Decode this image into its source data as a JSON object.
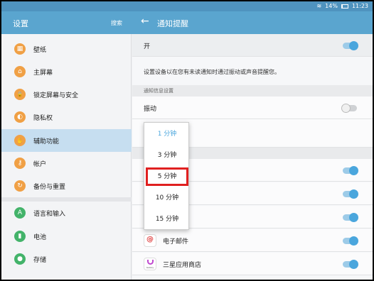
{
  "status_bar": {
    "battery": "14%",
    "time": "11:23"
  },
  "left_header": {
    "title": "设置",
    "search": "搜索"
  },
  "right_header": {
    "title": "通知提醒"
  },
  "sidebar": {
    "items": [
      {
        "label": "壁纸",
        "icon": "wallpaper-icon",
        "glyph": "▦"
      },
      {
        "label": "主屏幕",
        "icon": "home-icon",
        "glyph": "⌂"
      },
      {
        "label": "锁定屏幕与安全",
        "icon": "lock-icon",
        "glyph": "🔒"
      },
      {
        "label": "隐私权",
        "icon": "privacy-icon",
        "glyph": "◐"
      },
      {
        "label": "辅助功能",
        "icon": "accessibility-icon",
        "glyph": "✋"
      },
      {
        "label": "帐户",
        "icon": "key-icon",
        "glyph": "⚷"
      },
      {
        "label": "备份与重置",
        "icon": "backup-icon",
        "glyph": "↻"
      },
      {
        "label": "语言和输入",
        "icon": "language-icon",
        "glyph": "A"
      },
      {
        "label": "电池",
        "icon": "battery-icon",
        "glyph": "▮"
      },
      {
        "label": "存储",
        "icon": "storage-icon",
        "glyph": "●"
      }
    ]
  },
  "main": {
    "on_label": "开",
    "description": "设置设备以在您有未读通知时通过振动或声音提醒您。",
    "section_title": "通知信息设置",
    "vibrate_label": "振动",
    "apps": [
      {
        "label": "电子邮件",
        "icon": "email-icon"
      },
      {
        "label": "三星应用商店",
        "icon": "galaxy-apps-icon",
        "icon_text": "Galaxy"
      }
    ]
  },
  "dropdown": {
    "options": [
      "1 分钟",
      "3 分钟",
      "5 分钟",
      "10 分钟",
      "15 分钟"
    ],
    "selected": "1 分钟",
    "highlighted": "5 分钟"
  },
  "colors": {
    "app_bar": "#5aa5cf",
    "status_bar": "#4f93bf",
    "active_nav": "#c6def0",
    "toggle_on": "#4aa6dd",
    "highlight_box": "#e02020",
    "icon_orange": "#f0a045"
  }
}
